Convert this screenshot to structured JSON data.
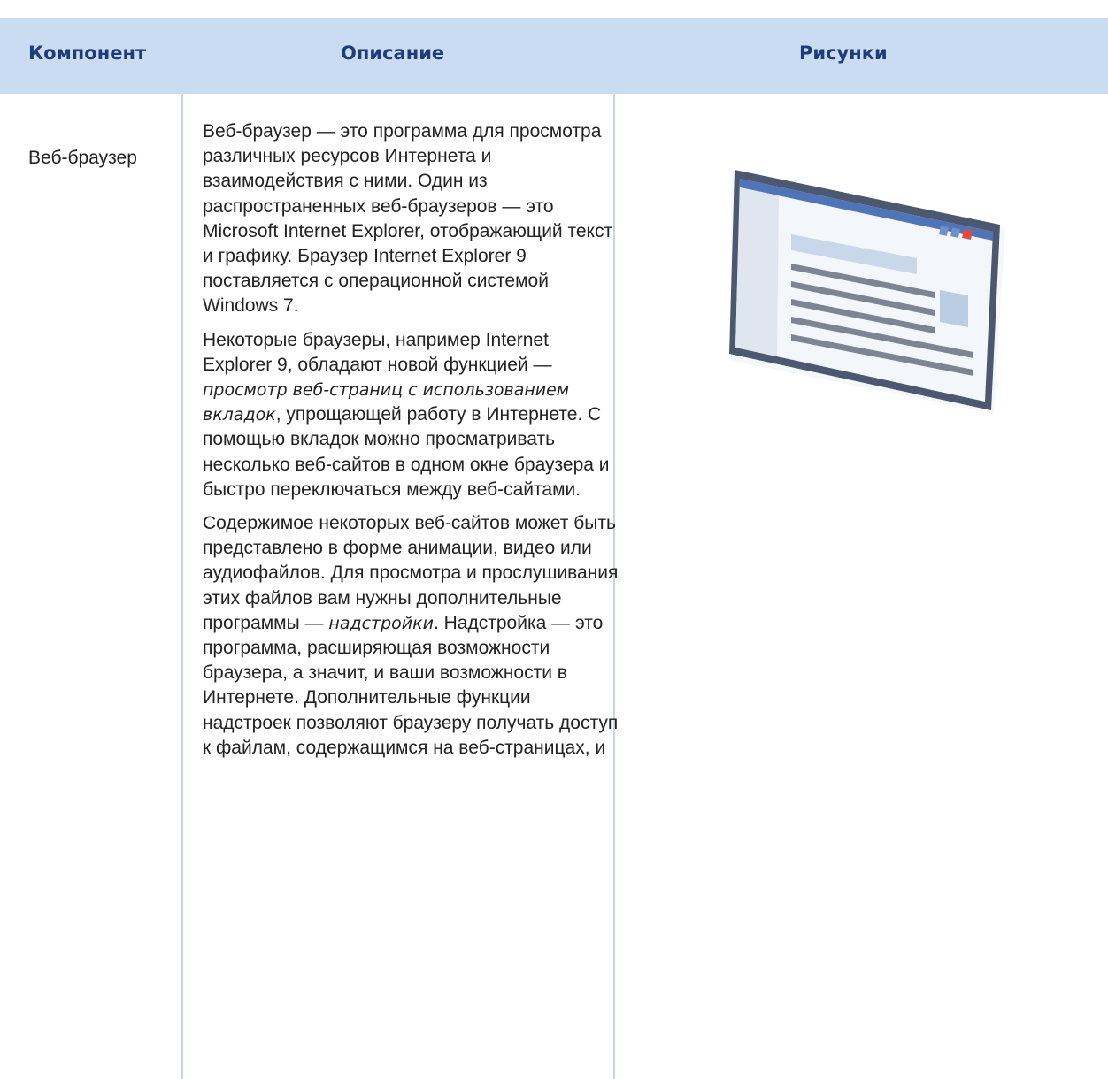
{
  "table": {
    "headers": {
      "component": "Компонент",
      "description": "Описание",
      "figures": "Рисунки"
    },
    "row": {
      "component": "Веб-браузер",
      "p1": "Веб-браузер — это программа для просмотра различных ресурсов Интернета и взаимодействия с ними. Один из распространенных веб-браузеров — это Microsoft Internet Explorer, отображающий текст и графику. Браузер Internet Explorer 9 поставляется с операционной системой Windows 7.",
      "p2_a": "Некоторые браузеры, например Internet Explorer 9, обладают новой функцией — ",
      "p2_em": "просмотр веб-страниц с использованием вкладок",
      "p2_b": ", упрощающей работу в Интернете. С помощью вкладок можно просматривать несколько веб-сайтов в одном окне браузера и быстро переключаться между веб-сайтами.",
      "p3_a": "Содержимое некоторых веб-сайтов может быть представлено в форме анимации, видео или аудиофайлов. Для просмотра и прослушивания этих файлов вам нужны дополнительные программы — ",
      "p3_em": "надстройки",
      "p3_b": ". Надстройка — это программа, расширяющая возможности браузера, а значит, и ваши возможности в Интернете. Дополнительные функции надстроек позволяют браузеру получать доступ к файлам, содержащимся на веб-страницах, и"
    }
  },
  "colors": {
    "header_bg": "#c9dcf1",
    "header_text": "#1d3c79",
    "grid_line": "#c2d5ec"
  },
  "icons": [
    "browser-window-illustration"
  ]
}
